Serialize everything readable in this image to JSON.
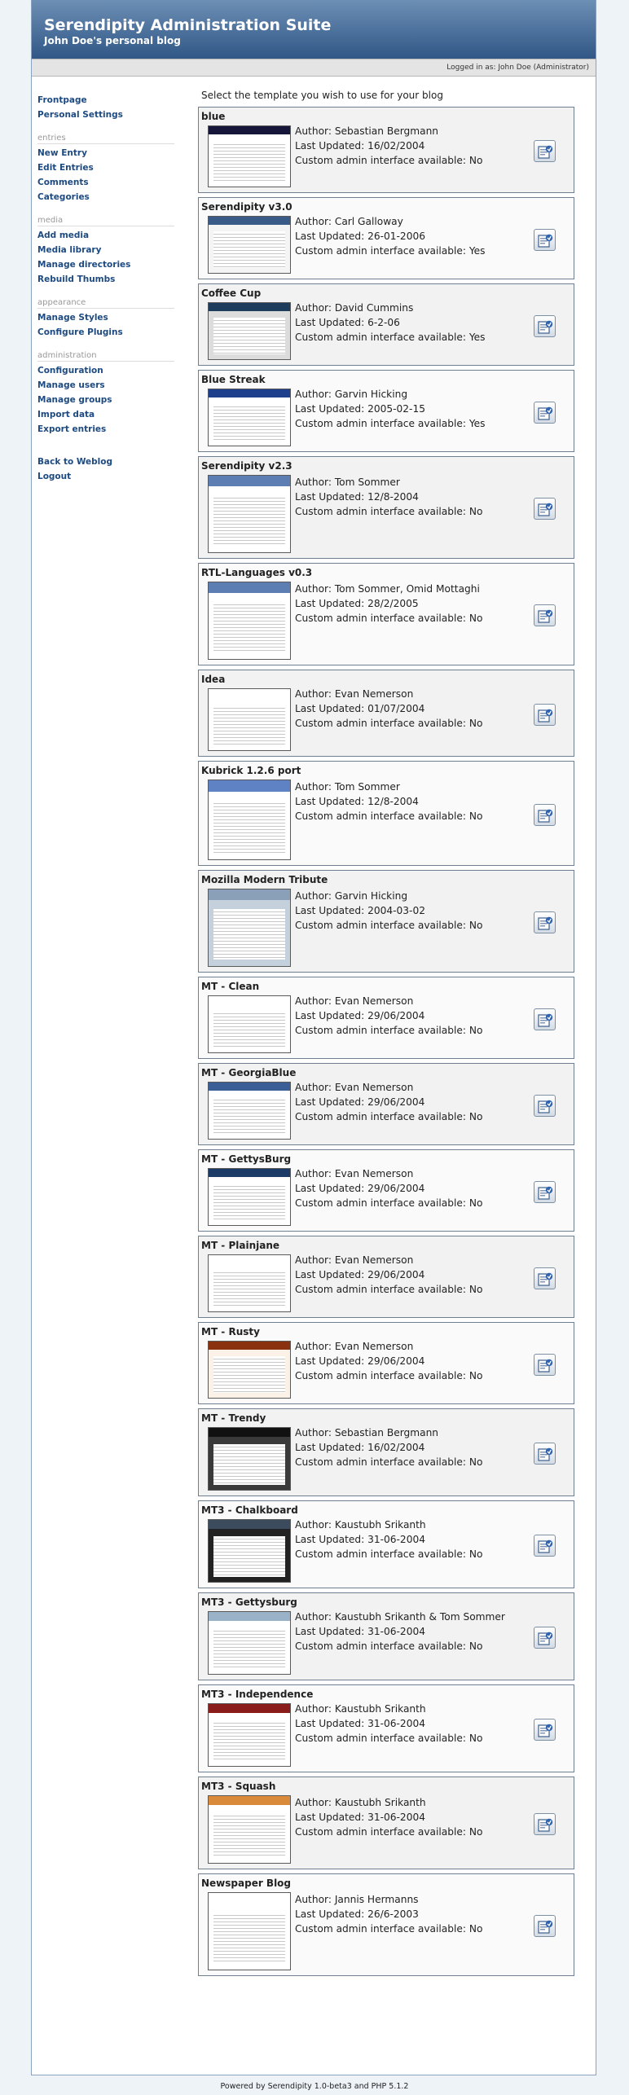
{
  "header": {
    "title": "Serendipity Administration Suite",
    "subtitle": "John Doe's personal blog",
    "login_status": "Logged in as: John Doe (Administrator)"
  },
  "sidebar": {
    "top": [
      "Frontpage",
      "Personal Settings"
    ],
    "sections": [
      {
        "title": "entries",
        "items": [
          "New Entry",
          "Edit Entries",
          "Comments",
          "Categories"
        ]
      },
      {
        "title": "media",
        "items": [
          "Add media",
          "Media library",
          "Manage directories",
          "Rebuild Thumbs"
        ]
      },
      {
        "title": "appearance",
        "items": [
          "Manage Styles",
          "Configure Plugins"
        ]
      },
      {
        "title": "administration",
        "items": [
          "Configuration",
          "Manage users",
          "Manage groups",
          "Import data",
          "Export entries"
        ]
      }
    ],
    "bottom": [
      "Back to Weblog",
      "Logout"
    ]
  },
  "main": {
    "intro": "Select the template you wish to use for your blog",
    "author_label": "Author: ",
    "updated_label": "Last Updated: ",
    "admin_label": "Custom admin interface available: ",
    "templates": [
      {
        "name": "blue",
        "author": "Sebastian Bergmann",
        "updated": "16/02/2004",
        "admin": "No",
        "colors": [
          "#16163a",
          "#ffffff"
        ]
      },
      {
        "name": "Serendipity v3.0",
        "author": "Carl Galloway",
        "updated": "26-01-2006",
        "admin": "Yes",
        "colors": [
          "#3a5a88",
          "#f4f4f4"
        ]
      },
      {
        "name": "Coffee Cup",
        "author": "David Cummins",
        "updated": "6-2-06",
        "admin": "Yes",
        "colors": [
          "#1e3d5c",
          "#dcdcdc"
        ]
      },
      {
        "name": "Blue Streak",
        "author": "Garvin Hicking",
        "updated": "2005-02-15",
        "admin": "Yes",
        "colors": [
          "#1d3f8c",
          "#ffffff"
        ]
      },
      {
        "name": "Serendipity v2.3",
        "author": "Tom Sommer",
        "updated": "12/8-2004",
        "admin": "No",
        "colors": [
          "#5d7eb2",
          "#ffffff"
        ]
      },
      {
        "name": "RTL-Languages v0.3",
        "author": "Tom Sommer, Omid Mottaghi",
        "updated": "28/2/2005",
        "admin": "No",
        "colors": [
          "#5d7eb2",
          "#ffffff"
        ]
      },
      {
        "name": "Idea",
        "author": "Evan Nemerson",
        "updated": "01/07/2004",
        "admin": "No",
        "colors": [
          "#ffffff",
          "#ffffff"
        ]
      },
      {
        "name": "Kubrick 1.2.6 port",
        "author": "Tom Sommer",
        "updated": "12/8-2004",
        "admin": "No",
        "colors": [
          "#5f82c4",
          "#ffffff"
        ]
      },
      {
        "name": "Mozilla Modern Tribute",
        "author": "Garvin Hicking",
        "updated": "2004-03-02",
        "admin": "No",
        "colors": [
          "#8aa0b8",
          "#c4d0dc"
        ]
      },
      {
        "name": "MT - Clean",
        "author": "Evan Nemerson",
        "updated": "29/06/2004",
        "admin": "No",
        "colors": [
          "#ffffff",
          "#ffffff"
        ]
      },
      {
        "name": "MT - GeorgiaBlue",
        "author": "Evan Nemerson",
        "updated": "29/06/2004",
        "admin": "No",
        "colors": [
          "#3a5f96",
          "#ffffff"
        ]
      },
      {
        "name": "MT - GettysBurg",
        "author": "Evan Nemerson",
        "updated": "29/06/2004",
        "admin": "No",
        "colors": [
          "#1c3a66",
          "#ffffff"
        ]
      },
      {
        "name": "MT - Plainjane",
        "author": "Evan Nemerson",
        "updated": "29/06/2004",
        "admin": "No",
        "colors": [
          "#ffffff",
          "#ffffff"
        ]
      },
      {
        "name": "MT - Rusty",
        "author": "Evan Nemerson",
        "updated": "29/06/2004",
        "admin": "No",
        "colors": [
          "#8a3210",
          "#fbf1e6"
        ]
      },
      {
        "name": "MT - Trendy",
        "author": "Sebastian Bergmann",
        "updated": "16/02/2004",
        "admin": "No",
        "colors": [
          "#111111",
          "#3a3a3a"
        ]
      },
      {
        "name": "MT3 - Chalkboard",
        "author": "Kaustubh Srikanth",
        "updated": "31-06-2004",
        "admin": "No",
        "colors": [
          "#3c4b5e",
          "#222222"
        ]
      },
      {
        "name": "MT3 - Gettysburg",
        "author": "Kaustubh Srikanth & Tom Sommer",
        "updated": "31-06-2004",
        "admin": "No",
        "colors": [
          "#9ab2c8",
          "#ffffff"
        ]
      },
      {
        "name": "MT3 - Independence",
        "author": "Kaustubh Srikanth",
        "updated": "31-06-2004",
        "admin": "No",
        "colors": [
          "#8a1c1c",
          "#ffffff"
        ]
      },
      {
        "name": "MT3 - Squash",
        "author": "Kaustubh Srikanth",
        "updated": "31-06-2004",
        "admin": "No",
        "colors": [
          "#d98a3a",
          "#ffffff"
        ]
      },
      {
        "name": "Newspaper Blog",
        "author": "Jannis Hermanns",
        "updated": "26/6-2003",
        "admin": "No",
        "colors": [
          "#ffffff",
          "#ffffff"
        ]
      }
    ]
  },
  "footer": "Powered by Serendipity 1.0-beta3 and PHP 5.1.2"
}
